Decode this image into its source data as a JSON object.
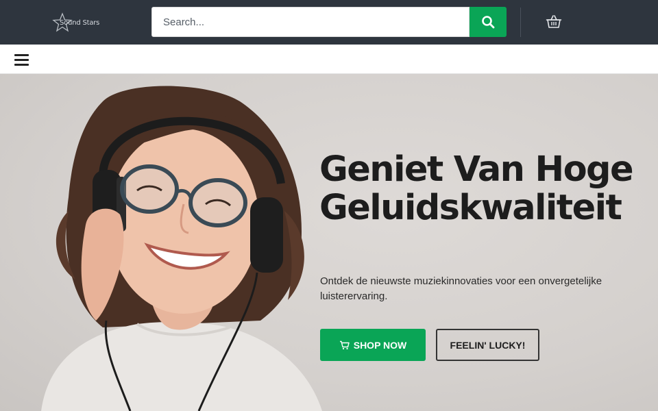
{
  "header": {
    "logo_text": "Sound Stars",
    "search": {
      "placeholder": "Search..."
    },
    "icons": {
      "search": "search-icon",
      "cart": "basket-icon",
      "menu": "hamburger-menu-icon"
    }
  },
  "hero": {
    "headline": "Geniet Van Hoge Geluidskwaliteit",
    "subtext": "Ontdek de nieuwste muziekinnovaties voor een onvergetelijke luisterervaring.",
    "primary_button": "SHOP NOW",
    "secondary_button": "FEELIN' LUCKY!",
    "image_alt": "Woman with glasses wearing headphones"
  },
  "colors": {
    "header_bg": "#2e353e",
    "accent": "#0aa556",
    "hero_bg": "#d8d4d1",
    "text": "#1d1d1d"
  }
}
